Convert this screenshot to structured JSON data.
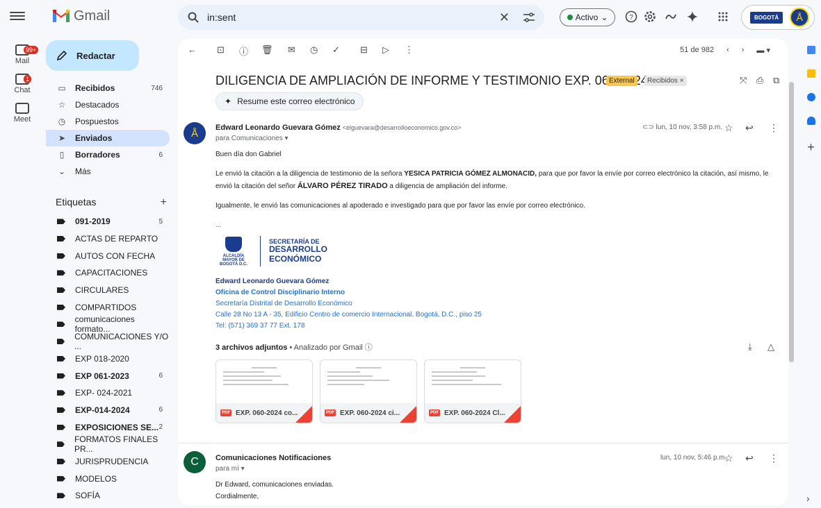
{
  "app": {
    "name": "Gmail"
  },
  "search": {
    "query": "in:sent"
  },
  "status": {
    "label": "Activo",
    "chevron": "⌄"
  },
  "account": {
    "org": "BOGOTÁ"
  },
  "rail": [
    {
      "label": "Mail",
      "badge": "99+"
    },
    {
      "label": "Chat",
      "badge": "1"
    },
    {
      "label": "Meet",
      "badge": ""
    }
  ],
  "compose": {
    "label": "Redactar"
  },
  "nav": [
    {
      "label": "Recibidos",
      "count": "746",
      "icon": "inbox-icon",
      "bold": true
    },
    {
      "label": "Destacados",
      "count": "",
      "icon": "star-icon"
    },
    {
      "label": "Pospuestos",
      "count": "",
      "icon": "clock-icon"
    },
    {
      "label": "Enviados",
      "count": "",
      "icon": "send-icon",
      "selected": true,
      "bold": true
    },
    {
      "label": "Borradores",
      "count": "6",
      "icon": "draft-icon",
      "bold": true
    },
    {
      "label": "Más",
      "count": "",
      "icon": "chevron-down-icon"
    }
  ],
  "labels_title": "Etiquetas",
  "labels": [
    {
      "label": "091-2019",
      "count": "5",
      "bold": true
    },
    {
      "label": "ACTAS DE REPARTO",
      "count": ""
    },
    {
      "label": "AUTOS CON FECHA",
      "count": ""
    },
    {
      "label": "CAPACITACIONES",
      "count": ""
    },
    {
      "label": "CIRCULARES",
      "count": ""
    },
    {
      "label": "COMPARTIDOS",
      "count": ""
    },
    {
      "label": "comunicaciones formato...",
      "count": ""
    },
    {
      "label": "COMUNICACIONES Y/O ...",
      "count": ""
    },
    {
      "label": "EXP 018-2020",
      "count": ""
    },
    {
      "label": "EXP 061-2023",
      "count": "6",
      "bold": true
    },
    {
      "label": "EXP- 024-2021",
      "count": ""
    },
    {
      "label": "EXP-014-2024",
      "count": "6",
      "bold": true
    },
    {
      "label": "EXPOSICIONES SE...",
      "count": "2",
      "bold": true
    },
    {
      "label": "FORMATOS FINALES PR...",
      "count": ""
    },
    {
      "label": "JURISPRUDENCIA",
      "count": ""
    },
    {
      "label": "MODELOS",
      "count": ""
    },
    {
      "label": "SOFÍA",
      "count": ""
    }
  ],
  "pager": {
    "position": "51 de 982"
  },
  "email": {
    "subject": "DILIGENCIA DE AMPLIACIÓN DE INFORME Y TESTIMONIO EXP. 060-2024",
    "chip_external": "External",
    "chip_inbox": "Recibidos ×",
    "summarize": "Resume este correo electrónico",
    "sender_name": "Edward Leonardo Guevara Gómez",
    "sender_email": "<elguevara@desarrolloeconomico.gov.co>",
    "to": "para Comunicaciones ▾",
    "date": "lun, 10 nov, 3:58 p.m.",
    "greeting": "Buen día don Gabriel",
    "p1a": "Le envió la citación a la diligencia de testimonio de la señora ",
    "p1b": "YESICA PATRICIA GÓMEZ ALMONACID,",
    "p1c": " para que por favor la envíe por correo electrónico la citación, así mismo, le envió la citación del señor ",
    "p1d": "ÁLVARO PÉREZ TIRADO",
    "p1e": " a diligencia de ampliación del informe.",
    "p2": "Igualmente, le envió las comunicaciones al apoderado e investigado para que por favor las envíe por correo electrónico.",
    "ellipsis": "...",
    "logo_crest": "ALCALDÍA MAYOR DE BOGOTÁ D.C.",
    "logo_l1": "SECRETARÍA DE",
    "logo_l2": "DESARROLLO",
    "logo_l3": "ECONÓMICO",
    "sig_name": "Edward Leonardo Guevara Gómez",
    "sig_office": "Oficina de Control Disciplinario Interno",
    "sig_entity": "Secretaría Distrital de Desarrollo Económico",
    "sig_address": "Calle 28 No 13 A - 35, Edificio Centro de comercio Internacional. Bogotá, D.C., piso 25",
    "sig_tel": "Tel: (571) 369 37 77 Ext. 178",
    "attach_count": "3 archivos adjuntos",
    "attach_note": " • Analizado por Gmail ⓘ",
    "attachments": [
      {
        "name": "EXP. 060-2024 co..."
      },
      {
        "name": "EXP. 060-2024 ci..."
      },
      {
        "name": "EXP. 060-2024 Cl..."
      }
    ]
  },
  "reply": {
    "avatar": "C",
    "sender": "Comunicaciones Notificaciones",
    "to": "para mí ▾",
    "date": "lun, 10 nov, 5:46 p.m.",
    "line1": "Dr Edward, comunicaciones enviadas.",
    "line2": "Cordialmente,"
  }
}
